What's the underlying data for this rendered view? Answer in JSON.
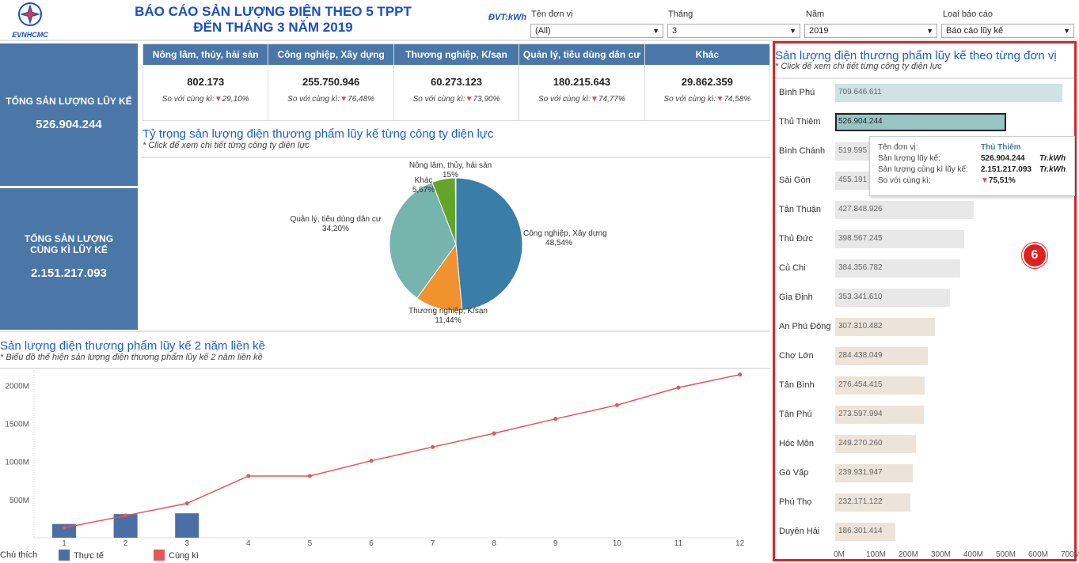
{
  "header": {
    "logo_text": "EVNHCMC",
    "title_line1": "BÁO CÁO SẢN LƯỢNG ĐIỆN THEO 5 TPPT",
    "title_line2": "ĐẾN THÁNG 3 NĂM 2019",
    "unit": "ĐVT:kWh"
  },
  "filters": [
    {
      "label": "Tên đơn vị",
      "value": "(All)"
    },
    {
      "label": "Tháng",
      "value": "3"
    },
    {
      "label": "Năm",
      "value": "2019"
    },
    {
      "label": "Loại báo cáo",
      "value": "Báo cáo lũy kế"
    }
  ],
  "summary": {
    "total_label": "TỔNG SẢN LƯỢNG LŨY KẾ",
    "total_value": "526.904.244",
    "prev_label": "TỔNG SẢN LƯỢNG CÙNG KÌ LŨY KẾ",
    "prev_value": "2.151.217.093"
  },
  "categories": [
    {
      "name": "Nông lâm, thủy, hải sản",
      "value": "802.173",
      "cmp_label": "So với cùng kì:",
      "cmp": "29,10%"
    },
    {
      "name": "Công nghiệp, Xây dựng",
      "value": "255.750.946",
      "cmp_label": "So với cùng kì:",
      "cmp": "76,48%"
    },
    {
      "name": "Thương nghiệp, K/sạn",
      "value": "60.273.123",
      "cmp_label": "So với cùng kì:",
      "cmp": "73,90%"
    },
    {
      "name": "Quản lý, tiêu dùng dân cư",
      "value": "180.215.643",
      "cmp_label": "So với cùng kì:",
      "cmp": "74,77%"
    },
    {
      "name": "Khác",
      "value": "29.862.359",
      "cmp_label": "So với cùng kì:",
      "cmp": "74,58%"
    }
  ],
  "pie_section": {
    "title": "Tỷ trọng sản lượng điện thương phẩm lũy kế từng công ty điện lực",
    "subtitle": "* Click để xem chi tiết từng công ty điện lực"
  },
  "line_section": {
    "title": "Sản lượng điện thương phẩm lũy kế 2 năm liền kề",
    "subtitle": "* Biểu đồ thể hiện sản lượng điện thương phẩm lũy kế 2 năm liền kề",
    "legend_title": "Chú thích",
    "legend_actual": "Thực tế",
    "legend_prev": "Cùng kì"
  },
  "bar_section": {
    "title": "Sản lượng điện thương phẩm lũy kế theo từng đơn vị",
    "subtitle": "* Click để xem chi tiết từng công ty điện lực",
    "badge": "6"
  },
  "tooltip": {
    "unit_label": "Tên đơn vị:",
    "unit_value": "Thủ Thiêm",
    "cur_label": "Sản lượng lũy kế:",
    "cur_value": "526.904.244",
    "cur_unit": "Tr.kWh",
    "prev_label": "Sản lượng cùng kì lũy kế:",
    "prev_value": "2.151.217.093",
    "prev_unit": "Tr.kWh",
    "cmp_label": "So với cùng kì:",
    "cmp_value": "75,51%"
  },
  "colors": {
    "header_blue": "#4a77a8",
    "pie_cn": "#3a7da6",
    "pie_tn": "#f0922e",
    "pie_ql": "#76b4ae",
    "pie_khac": "#62a527",
    "pie_nl": "#d7b43a",
    "bar_actual": "#4a6fa5",
    "line_prev": "#e05858",
    "bar_teal": "#cfe3e3",
    "bar_teal_dark": "#97c5c4",
    "bar_beige": "#ede4d9",
    "bar_grey": "#e8e8e8",
    "highlight_red": "#d62728"
  },
  "chart_data": [
    {
      "type": "pie",
      "labels": [
        "Công nghiệp, Xây dựng",
        "Thương nghiệp, K/sạn",
        "Quản lý, tiêu dùng dân cư",
        "Khác",
        "Nông lâm, thủy, hải sản"
      ],
      "values": [
        48.54,
        11.44,
        34.2,
        5.67,
        0.15
      ],
      "value_labels": [
        "48,54%",
        "11,44%",
        "34,20%",
        "5,67%",
        "15%"
      ]
    },
    {
      "type": "bar",
      "x": [
        1,
        2,
        3,
        4,
        5,
        6,
        7,
        8,
        9,
        10,
        11,
        12
      ],
      "series": [
        {
          "name": "Thực tế",
          "type": "bar",
          "values": [
            180,
            310,
            320,
            null,
            null,
            null,
            null,
            null,
            null,
            null,
            null,
            null
          ]
        },
        {
          "name": "Cùng kì",
          "type": "line",
          "values": [
            130,
            290,
            450,
            810,
            810,
            1010,
            1190,
            1370,
            1560,
            1740,
            1970,
            2140
          ]
        }
      ],
      "yticks": [
        "500M",
        "1000M",
        "1500M",
        "2000M"
      ],
      "ylim": [
        0,
        2200
      ]
    },
    {
      "type": "bar",
      "orientation": "horizontal",
      "categories": [
        "Bình Phú",
        "Thủ Thiêm",
        "Bình Chánh",
        "Sài Gòn",
        "Tân Thuận",
        "Thủ Đức",
        "Củ Chi",
        "Gia Định",
        "An Phú Đông",
        "Chợ Lớn",
        "Tân Bình",
        "Tân Phú",
        "Hóc Môn",
        "Gò Vấp",
        "Phú Thọ",
        "Duyên Hải"
      ],
      "values": [
        709646611,
        526904244,
        519595000,
        455191000,
        427848926,
        398567245,
        384356782,
        353341610,
        307310482,
        284438049,
        276454415,
        273597994,
        249270260,
        239931947,
        232171122,
        186301414
      ],
      "value_labels": [
        "709.646.611",
        "526.904.244",
        "519.595",
        "455.191",
        "427.848.926",
        "398.567.245",
        "384.356.782",
        "353.341.610",
        "307.310.482",
        "284.438.049",
        "276.454.415",
        "273.597.994",
        "249.270.260",
        "239.931.947",
        "232.171.122",
        "186.301.414"
      ],
      "xticks": [
        "0M",
        "100M",
        "200M",
        "300M",
        "400M",
        "500M",
        "600M",
        "700M"
      ],
      "xlim": [
        0,
        700
      ]
    }
  ]
}
